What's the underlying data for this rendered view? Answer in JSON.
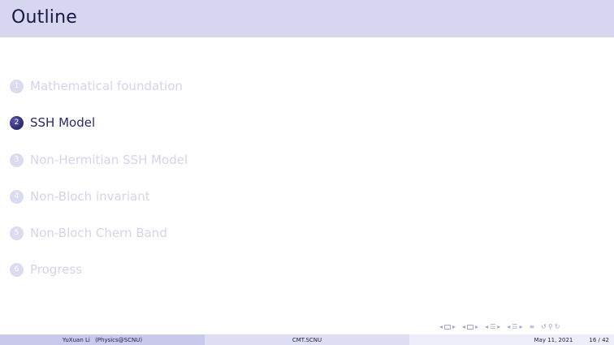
{
  "header": {
    "title": "Outline"
  },
  "outline": {
    "items": [
      {
        "number": "1",
        "label": "Mathematical foundation",
        "active": false
      },
      {
        "number": "2",
        "label": "SSH Model",
        "active": true
      },
      {
        "number": "3",
        "label": "Non-Hermitian SSH Model",
        "active": false
      },
      {
        "number": "4",
        "label": "Non-Bloch invariant",
        "active": false
      },
      {
        "number": "5",
        "label": "Non-Bloch Chern Band",
        "active": false
      },
      {
        "number": "6",
        "label": "Progress",
        "active": false
      }
    ]
  },
  "footer": {
    "author": "YuXuan Li",
    "institution": "(Physics@SCNU)",
    "center": "CMT.SCNU",
    "date": "May 11, 2021",
    "page": "16 / 42"
  },
  "colors": {
    "header_bg": "#d6d6f0",
    "active_text": "#2a2a6e",
    "inactive_text": "#d4d4ec",
    "footer_left": "#c9c9ec",
    "footer_center": "#dedef4",
    "footer_right": "#eeeefb"
  }
}
